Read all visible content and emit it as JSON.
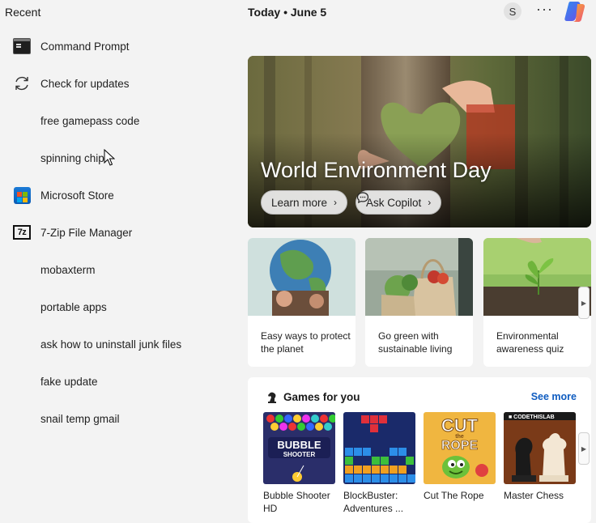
{
  "left": {
    "title": "Recent",
    "items": [
      {
        "label": "Command Prompt",
        "icon": "command-prompt-icon"
      },
      {
        "label": "Check for updates",
        "icon": "refresh-icon"
      },
      {
        "label": "free gamepass code",
        "icon": ""
      },
      {
        "label": "spinning chip",
        "icon": ""
      },
      {
        "label": "Microsoft Store",
        "icon": "microsoft-store-icon"
      },
      {
        "label": "7-Zip File Manager",
        "icon": "7zip-icon"
      },
      {
        "label": "mobaxterm",
        "icon": ""
      },
      {
        "label": "portable apps",
        "icon": ""
      },
      {
        "label": "ask how to uninstall junk files",
        "icon": ""
      },
      {
        "label": "fake update",
        "icon": ""
      },
      {
        "label": "snail temp gmail",
        "icon": ""
      }
    ]
  },
  "header": {
    "date": "Today  •  June 5",
    "avatar_letter": "S",
    "more": "···"
  },
  "hero": {
    "title": "World Environment Day",
    "learn_more": "Learn more",
    "ask_copilot": "Ask Copilot"
  },
  "cards": [
    {
      "text": "Easy ways to protect the planet"
    },
    {
      "text": "Go green with sustainable living"
    },
    {
      "text": "Environmental awareness quiz"
    }
  ],
  "games": {
    "title": "Games for you",
    "see_more": "See more",
    "items": [
      {
        "name": "Bubble Shooter HD",
        "art_text": "BUBBLE SHOOTER"
      },
      {
        "name": "BlockBuster: Adventures ...",
        "art_text": ""
      },
      {
        "name": "Cut The Rope",
        "art_text": "CUT the ROPE"
      },
      {
        "name": "Master Chess",
        "art_text": "CODETHISLAB"
      }
    ]
  },
  "colors": {
    "accent": "#0f5cc0",
    "background": "#f3f3f3"
  }
}
